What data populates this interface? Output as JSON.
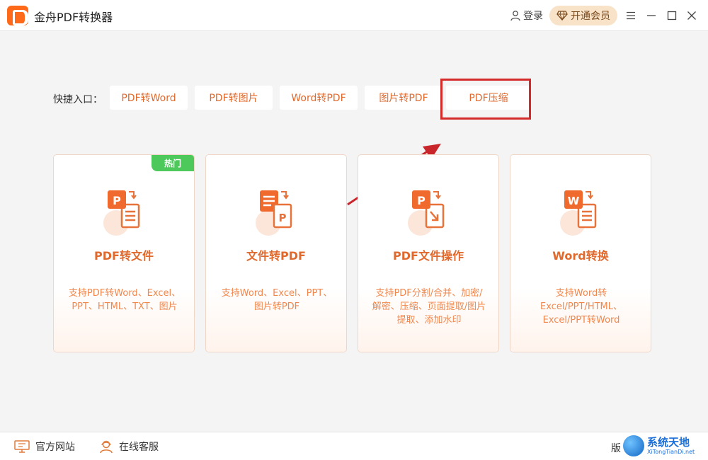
{
  "app": {
    "title": "金舟PDF转换器"
  },
  "header": {
    "login_label": "登录",
    "vip_label": "开通会员",
    "icons": {
      "menu": "menu-icon",
      "minimize": "minimize-icon",
      "maximize": "maximize-icon",
      "close": "close-icon"
    }
  },
  "shortcuts": {
    "label": "快捷入口：",
    "items": [
      {
        "label": "PDF转Word"
      },
      {
        "label": "PDF转图片"
      },
      {
        "label": "Word转PDF"
      },
      {
        "label": "图片转PDF"
      },
      {
        "label": "PDF压缩"
      }
    ]
  },
  "cards": [
    {
      "title": "PDF转文件",
      "desc": "支持PDF转Word、Excel、PPT、HTML、TXT、图片",
      "badge": "热门",
      "icon": "pdf-to-file-icon"
    },
    {
      "title": "文件转PDF",
      "desc": "支持Word、Excel、PPT、图片转PDF",
      "icon": "file-to-pdf-icon"
    },
    {
      "title": "PDF文件操作",
      "desc": "支持PDF分割/合并、加密/解密、压缩、页面提取/图片提取、添加水印",
      "icon": "pdf-operations-icon"
    },
    {
      "title": "Word转换",
      "desc": "支持Word转Excel/PPT/HTML、Excel/PPT转Word",
      "icon": "word-convert-icon"
    }
  ],
  "footer": {
    "website_label": "官方网站",
    "service_label": "在线客服",
    "version_label": "版"
  },
  "watermark": {
    "main": "系统天地",
    "sub": "XiTongTianDi.net"
  },
  "colors": {
    "accent": "#e06a2e",
    "highlight": "#d42a2a",
    "hot": "#4cc95a",
    "vip_bg": "#f8e3c9"
  }
}
